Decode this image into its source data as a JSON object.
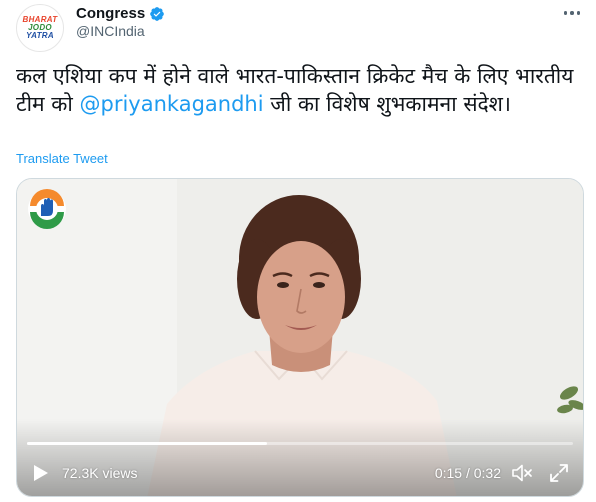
{
  "author": {
    "avatar_lines": [
      "BHARAT",
      "JODO",
      "YATRA"
    ],
    "display_name": "Congress",
    "handle": "@INCIndia",
    "verified": true
  },
  "tweet": {
    "text_before": "कल एशिया कप में होने वाले भारत-पाकिस्तान क्रिकेट मैच के लिए भारतीय टीम को ",
    "mention": "@priyankagandhi",
    "text_after": " जी का विशेष शुभकामना संदेश।",
    "translate_label": "Translate Tweet"
  },
  "video": {
    "views": "72.3K views",
    "time": "0:15 / 0:32",
    "progress": 0.44
  },
  "icons": {
    "more": "more-options-icon",
    "verified": "verified-badge-icon",
    "play": "play-icon",
    "mute": "mute-icon",
    "fullscreen": "fullscreen-icon"
  },
  "colors": {
    "link": "#1d9bf0",
    "verified": "#1d9bf0",
    "text": "#0f1419",
    "secondary": "#536471"
  }
}
